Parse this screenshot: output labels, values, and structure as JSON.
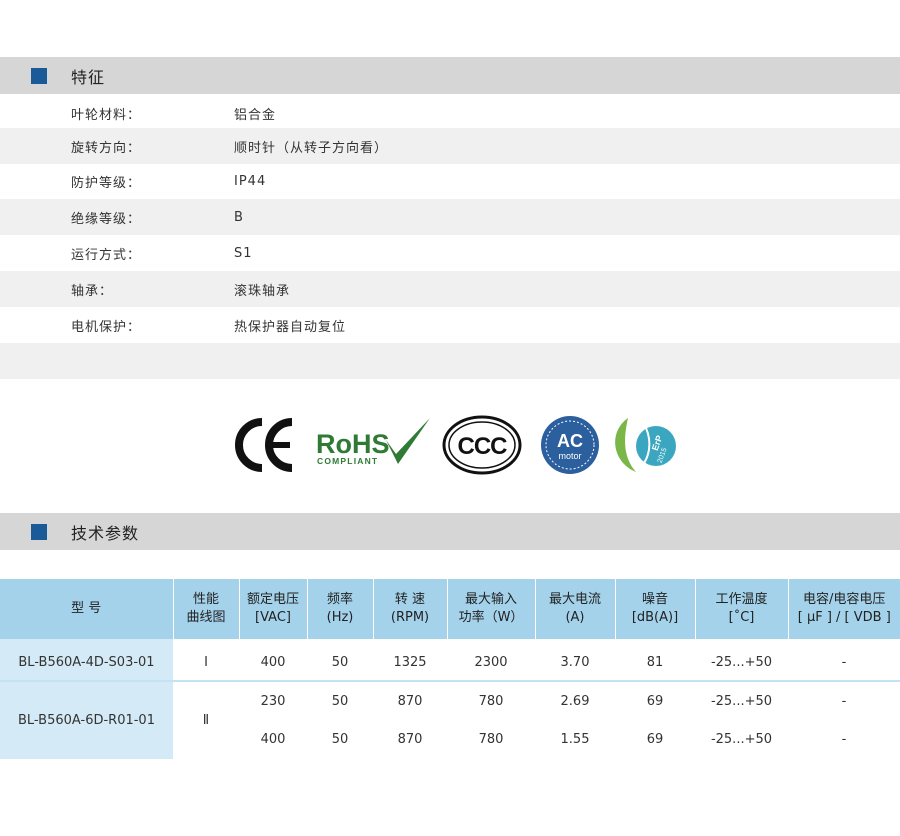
{
  "features": {
    "title": "特征",
    "rows": [
      {
        "label": "叶轮材料：",
        "value": "铝合金"
      },
      {
        "label": "旋转方向：",
        "value": "顺时针（从转子方向看）"
      },
      {
        "label": "防护等级：",
        "value": "IP44"
      },
      {
        "label": "绝缘等级：",
        "value": "B"
      },
      {
        "label": "运行方式：",
        "value": "S1"
      },
      {
        "label": "轴承：",
        "value": "滚珠轴承"
      },
      {
        "label": "电机保护：",
        "value": "热保护器自动复位"
      }
    ]
  },
  "certifications": {
    "ce": "CE",
    "rohs": "RoHS",
    "rohs_sub": "COMPLIANT",
    "ccc": "CCC",
    "acmotor_top": "AC",
    "acmotor_bottom": "motor",
    "erp": "ErP",
    "erp_year": "2015"
  },
  "specs": {
    "title": "技术参数",
    "headers": [
      {
        "l1": "型 号",
        "l2": ""
      },
      {
        "l1": "性能",
        "l2": "曲线图"
      },
      {
        "l1": "额定电压",
        "l2": "[VAC]"
      },
      {
        "l1": "频率",
        "l2": "(Hz)"
      },
      {
        "l1": "转 速",
        "l2": "(RPM)"
      },
      {
        "l1": "最大输入",
        "l2": "功率（W）"
      },
      {
        "l1": "最大电流",
        "l2": "(A)"
      },
      {
        "l1": "噪音",
        "l2": "[dB(A)]"
      },
      {
        "l1": "工作温度",
        "l2": "[˚C]"
      },
      {
        "l1": "电容/电容电压",
        "l2": "[ µF ] / [ VDB ]"
      }
    ],
    "models": [
      {
        "model": "BL-B560A-4D-S03-01",
        "curve": "Ⅰ",
        "rows": [
          {
            "voltage": "400",
            "freq": "50",
            "rpm": "1325",
            "power": "2300",
            "current": "3.70",
            "noise": "81",
            "temp": "-25...+50",
            "cap": "-"
          }
        ]
      },
      {
        "model": "BL-B560A-6D-R01-01",
        "curve": "Ⅱ",
        "rows": [
          {
            "voltage": "230",
            "freq": "50",
            "rpm": "870",
            "power": "780",
            "current": "2.69",
            "noise": "69",
            "temp": "-25...+50",
            "cap": "-"
          },
          {
            "voltage": "400",
            "freq": "50",
            "rpm": "870",
            "power": "780",
            "current": "1.55",
            "noise": "69",
            "temp": "-25...+50",
            "cap": "-"
          }
        ]
      }
    ]
  },
  "colors": {
    "accent": "#1a5a98",
    "header_bg": "#d6d6d6",
    "table_header": "#a4d2ea",
    "table_model_bg": "#d4ebf7",
    "rohs_green": "#2f7a35",
    "acmotor_blue": "#2c5f9e",
    "erp_teal": "#3aa6c0"
  }
}
